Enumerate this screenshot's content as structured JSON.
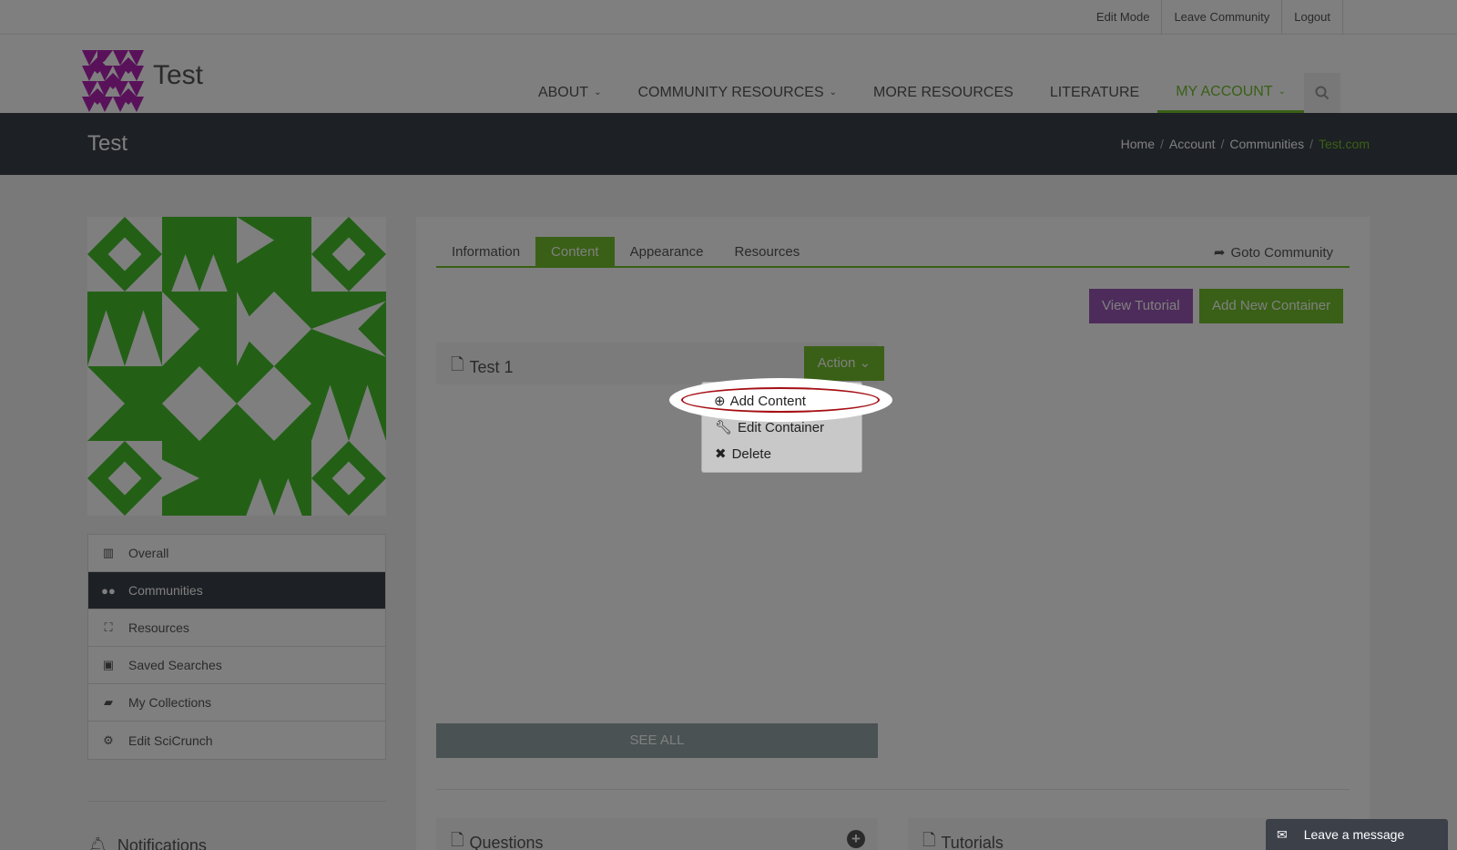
{
  "topbar": {
    "links": [
      "Edit Mode",
      "Leave Community",
      "Logout"
    ]
  },
  "header": {
    "brand": "Test",
    "nav": [
      {
        "label": "ABOUT",
        "has_caret": true
      },
      {
        "label": "COMMUNITY RESOURCES",
        "has_caret": true
      },
      {
        "label": "MORE RESOURCES",
        "has_caret": false
      },
      {
        "label": "LITERATURE",
        "has_caret": false
      },
      {
        "label": "MY ACCOUNT",
        "has_caret": true,
        "active": true
      }
    ],
    "search_icon": "search-icon"
  },
  "breadcrumbs": {
    "title": "Test",
    "items": [
      "Home",
      "Account",
      "Communities"
    ],
    "current": "Test.com"
  },
  "side_menu": [
    {
      "label": "Overall",
      "icon": "bar-chart-icon"
    },
    {
      "label": "Communities",
      "icon": "users-icon",
      "active": true
    },
    {
      "label": "Resources",
      "icon": "cubes-icon"
    },
    {
      "label": "Saved Searches",
      "icon": "floppy-icon"
    },
    {
      "label": "My Collections",
      "icon": "folder-open-icon"
    },
    {
      "label": "Edit SciCrunch",
      "icon": "cogs-icon"
    }
  ],
  "notifications": {
    "label": "Notifications"
  },
  "tabs": [
    {
      "label": "Information"
    },
    {
      "label": "Content",
      "active": true
    },
    {
      "label": "Appearance"
    },
    {
      "label": "Resources"
    }
  ],
  "goto_label": "Goto Community",
  "buttons": {
    "view_tutorial": "View Tutorial",
    "add_container": "Add New Container"
  },
  "container": {
    "name": "Test 1",
    "action_label": "Action"
  },
  "dropdown": {
    "add_content": "Add Content",
    "edit_container": "Edit Container",
    "delete": "Delete"
  },
  "see_all": "SEE ALL",
  "sub_containers": {
    "questions": "Questions",
    "tutorials": "Tutorials"
  },
  "chat": {
    "label": "Leave a message"
  },
  "colors": {
    "accent": "#72c02c",
    "dark": "#3b4049",
    "purple": "#9b59b6",
    "highlight_ring": "#a50f15"
  }
}
